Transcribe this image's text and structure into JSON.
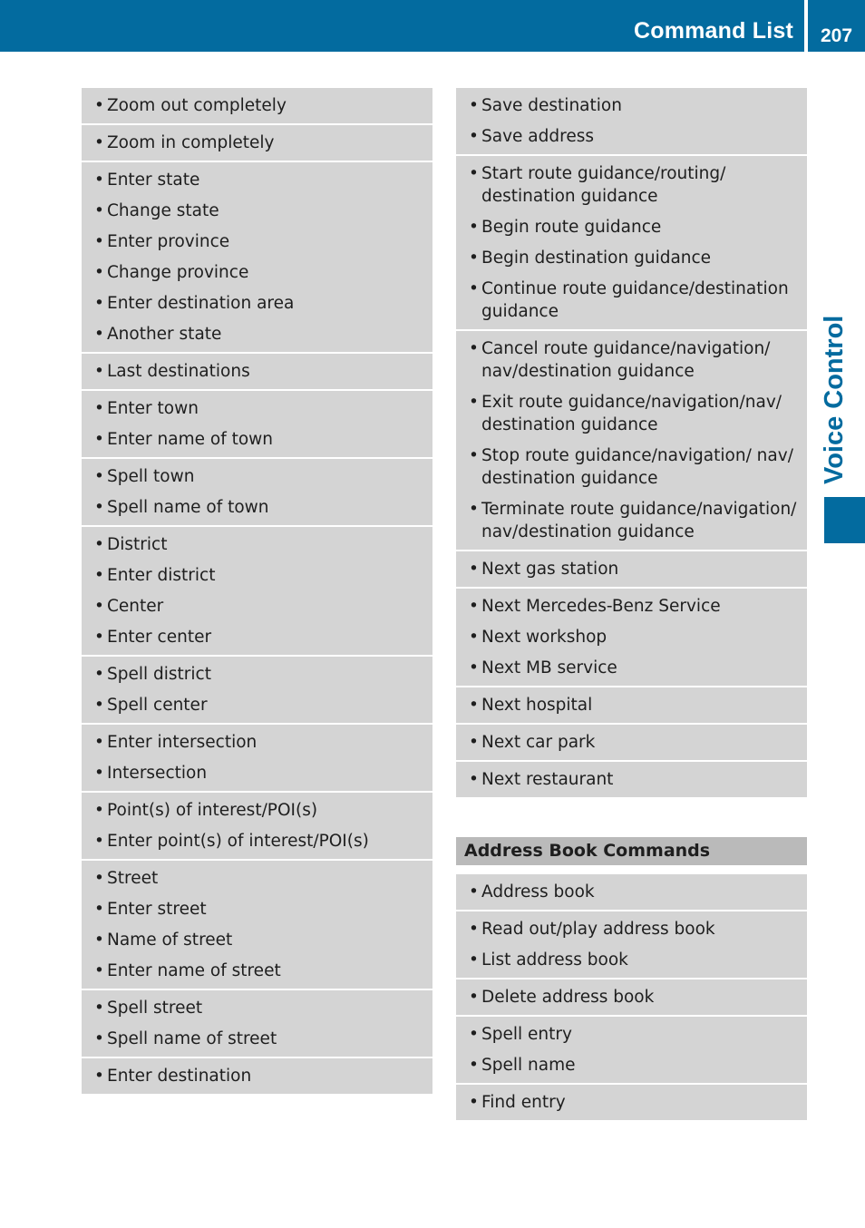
{
  "header": {
    "title": "Command List",
    "page_number": "207"
  },
  "side_tab": {
    "label": "Voice Control"
  },
  "colors": {
    "accent": "#036b9f",
    "cell_bg": "#d4d4d4",
    "section_head_bg": "#bababa"
  },
  "left_column": {
    "groups": [
      {
        "items": [
          "Zoom out completely"
        ]
      },
      {
        "items": [
          "Zoom in completely"
        ]
      },
      {
        "items": [
          "Enter state",
          "Change state",
          "Enter province",
          "Change province",
          "Enter destination area",
          "Another state"
        ]
      },
      {
        "items": [
          "Last destinations"
        ]
      },
      {
        "items": [
          "Enter town",
          "Enter name of town"
        ]
      },
      {
        "items": [
          "Spell town",
          "Spell name of town"
        ]
      },
      {
        "items": [
          "District",
          "Enter district",
          "Center",
          "Enter center"
        ]
      },
      {
        "items": [
          "Spell district",
          "Spell center"
        ]
      },
      {
        "items": [
          "Enter intersection",
          "Intersection"
        ]
      },
      {
        "items": [
          "Point(s) of interest/POI(s)",
          "Enter point(s) of interest/POI(s)"
        ]
      },
      {
        "items": [
          "Street",
          "Enter street",
          "Name of street",
          "Enter name of street"
        ]
      },
      {
        "items": [
          "Spell street",
          "Spell name of street"
        ]
      },
      {
        "items": [
          "Enter destination"
        ]
      }
    ]
  },
  "right_column": {
    "groups": [
      {
        "items": [
          "Save destination",
          "Save address"
        ]
      },
      {
        "items": [
          "Start route guidance/routing/ destination guidance",
          "Begin route guidance",
          "Begin destination guidance",
          "Continue route guidance/destination guidance"
        ]
      },
      {
        "items": [
          "Cancel route guidance/navigation/ nav/destination guidance",
          "Exit route guidance/navigation/nav/ destination guidance",
          "Stop route guidance/navigation/ nav/ destination guidance",
          "Terminate route guidance/navigation/ nav/destination guidance"
        ]
      },
      {
        "items": [
          "Next gas station"
        ]
      },
      {
        "items": [
          "Next Mercedes-Benz Service",
          "Next workshop",
          "Next MB service"
        ]
      },
      {
        "items": [
          "Next hospital"
        ]
      },
      {
        "items": [
          "Next car park"
        ]
      },
      {
        "items": [
          "Next restaurant"
        ]
      }
    ],
    "section": {
      "title": "Address Book Commands",
      "groups": [
        {
          "items": [
            "Address book"
          ]
        },
        {
          "items": [
            "Read out/play address book",
            "List address book"
          ]
        },
        {
          "items": [
            "Delete address book"
          ]
        },
        {
          "items": [
            "Spell entry",
            "Spell name"
          ]
        },
        {
          "items": [
            "Find entry"
          ]
        }
      ]
    }
  }
}
